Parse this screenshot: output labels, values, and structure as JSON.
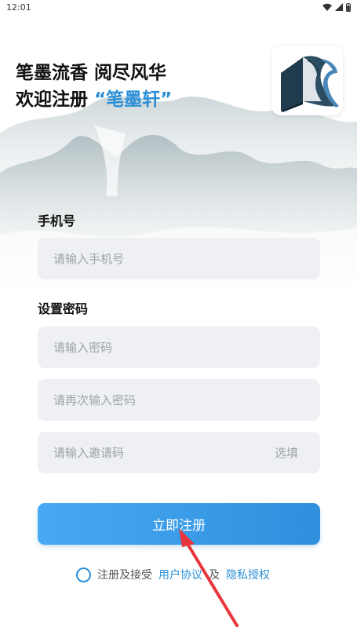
{
  "status_bar": {
    "time": "12:01"
  },
  "header": {
    "line1": "笔墨流香 阅尽风华",
    "line2_prefix": "欢迎注册",
    "brand": "“笔墨轩”"
  },
  "logo": {
    "icon": "book-logo-icon"
  },
  "form": {
    "phone_label": "手机号",
    "phone_placeholder": "请输入手机号",
    "password_label": "设置密码",
    "password_placeholder": "请输入密码",
    "confirm_placeholder": "请再次输入密码",
    "invite_placeholder": "请输入邀请码",
    "invite_hint": "选填"
  },
  "actions": {
    "register_label": "立即注册"
  },
  "agreement": {
    "prefix": "注册及接受",
    "user_agreement": "用户协议",
    "and": "及",
    "privacy": "隐私授权"
  },
  "colors": {
    "accent": "#2a8fd6",
    "field_bg": "#eef0f3",
    "arrow": "#e8363a"
  }
}
